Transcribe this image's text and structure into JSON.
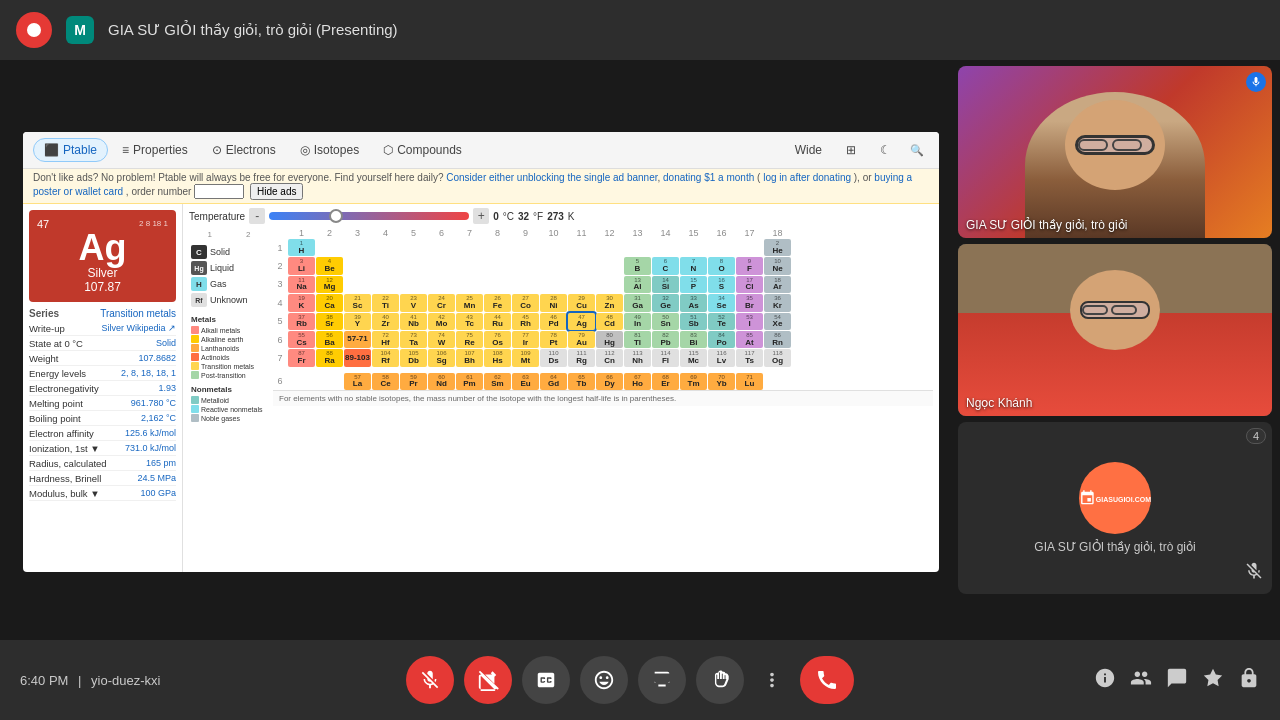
{
  "topbar": {
    "record_indicator": "●",
    "meet_icon": "M",
    "meeting_title": "GIA SƯ GIỎI thầy giỏi, trò giỏi (Presenting)"
  },
  "ptable": {
    "tabs": [
      {
        "label": "Ptable",
        "icon": "⬛",
        "active": true
      },
      {
        "label": "Properties",
        "icon": "≡"
      },
      {
        "label": "Electrons",
        "icon": "⊙"
      },
      {
        "label": "Isotopes",
        "icon": "◎"
      },
      {
        "label": "Compounds",
        "icon": "⬡"
      },
      {
        "label": "Wide",
        "icon": "⬛"
      },
      {
        "label": "Grid",
        "icon": "⊞"
      },
      {
        "label": "Dark",
        "icon": "☾"
      }
    ],
    "ad_text": "Don't like ads? No problem! Ptable will always be free for everyone. Find yourself here daily?",
    "ad_links": [
      "Consider either unblocking the single ad banner",
      "donating $1 a month",
      "log in after donating",
      "buying a poster or wallet card"
    ],
    "ad_order": "order number",
    "ad_hide": "Hide ads",
    "temperature_label": "Temperature",
    "temp_minus": "-",
    "temp_plus": "+",
    "temp_value": "0",
    "temp_unit_c": "°C",
    "temp_value_f": "32",
    "temp_unit_f": "°F",
    "temp_value_k": "273",
    "temp_unit_k": "K",
    "element": {
      "number": "47",
      "config": "2 8 18 1",
      "symbol": "Ag",
      "name": "Silver",
      "mass": "107.87"
    },
    "series_label": "Series",
    "series_value": "Transition metals",
    "properties": [
      {
        "label": "Write-up",
        "value": "Silver Wikipedia ↗"
      },
      {
        "label": "State at _ 0 °C ▼",
        "value": "Solid"
      },
      {
        "label": "Weight",
        "value": "107.8682 ▼"
      },
      {
        "label": "Energy levels",
        "value": "2, 8, 18, 18, 1"
      },
      {
        "label": "Electronegativity",
        "value": "1.93"
      },
      {
        "label": "Melting point",
        "value": "961.780 °C"
      },
      {
        "label": "Boiling point",
        "value": "2,162 °C"
      },
      {
        "label": "Electron affinity",
        "value": "125.6 kJ/mol"
      },
      {
        "label": "Ionization, 1st ▼",
        "value": "731.0 kJ/mol ▼"
      },
      {
        "label": "Radius, calculated ▼",
        "value": "165 pm ▼"
      },
      {
        "label": "Hardness, Brinell ▼",
        "value": "24.5 MPa ▼"
      },
      {
        "label": "Modulus, bulk ▼",
        "value": "100 GPa ▼"
      }
    ],
    "legend": [
      {
        "symbol": "C",
        "label": "Solid",
        "color": "#333"
      },
      {
        "symbol": "Hg",
        "label": "Liquid",
        "color": "#555"
      },
      {
        "symbol": "H",
        "label": "Gas",
        "color": "#777"
      },
      {
        "symbol": "Rf",
        "label": "Unknown",
        "color": "#999"
      }
    ],
    "info_text": "For elements with no stable isotopes, the mass number of the isotope with the longest half-life is in parentheses."
  },
  "videos": {
    "panel1": {
      "name": "GIA SƯ GIỎI thầy giỏi, trò giỏi",
      "has_audio": true,
      "badge_icon": "🎤"
    },
    "panel2": {
      "name": "Ngọc Khánh",
      "has_audio": false
    },
    "panel3": {
      "name": "GIA SƯ GIỎI thầy giỏi, trò giỏi",
      "avatar_text": "GIASUGIOI.COM",
      "is_muted": true,
      "participant_count": "4"
    }
  },
  "bottombar": {
    "time": "6:40 PM",
    "separator": "|",
    "meeting_code": "yio-duez-kxi",
    "controls": [
      {
        "id": "mic",
        "icon": "🎤",
        "active_red": true
      },
      {
        "id": "camera",
        "icon": "📷",
        "active_red": true
      },
      {
        "id": "captions",
        "icon": "CC"
      },
      {
        "id": "emoji",
        "icon": "😊"
      },
      {
        "id": "present",
        "icon": "⬆"
      },
      {
        "id": "hand",
        "icon": "✋"
      },
      {
        "id": "more",
        "icon": "⋮"
      },
      {
        "id": "end",
        "icon": "📞"
      }
    ],
    "right_icons": [
      {
        "id": "info",
        "icon": "ℹ"
      },
      {
        "id": "people",
        "icon": "👥"
      },
      {
        "id": "chat",
        "icon": "💬"
      },
      {
        "id": "activities",
        "icon": "✤"
      },
      {
        "id": "lock",
        "icon": "🔒"
      }
    ]
  }
}
